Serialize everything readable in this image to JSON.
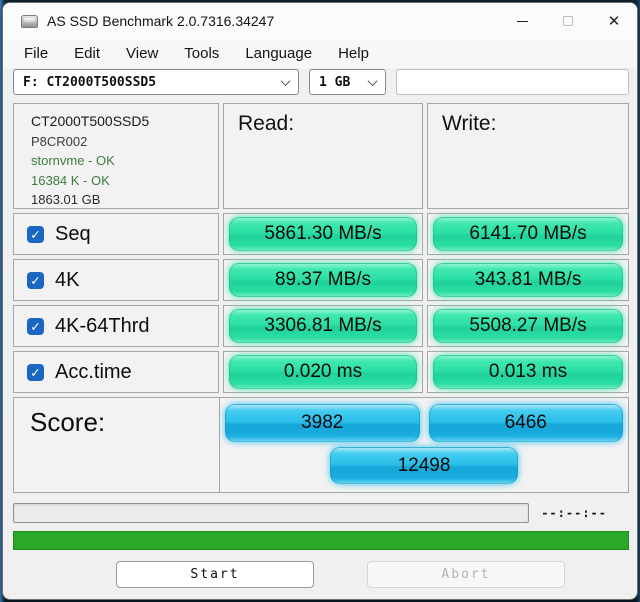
{
  "window": {
    "title": "AS SSD Benchmark 2.0.7316.34247"
  },
  "icons": {
    "close": "✕",
    "checkmark": "✓"
  },
  "menu": {
    "items": [
      {
        "label": "File"
      },
      {
        "label": "Edit"
      },
      {
        "label": "View"
      },
      {
        "label": "Tools"
      },
      {
        "label": "Language"
      },
      {
        "label": "Help"
      }
    ]
  },
  "toolbar": {
    "drive": "F: CT2000T500SSD5",
    "test_size": "1 GB"
  },
  "device": {
    "model": "CT2000T500SSD5",
    "firmware": "P8CR002",
    "driver_status": "stornvme - OK",
    "alignment_status": "16384 K - OK",
    "capacity": "1863.01 GB"
  },
  "results": {
    "read_header": "Read:",
    "write_header": "Write:",
    "rows": [
      {
        "label": "Seq",
        "checked": true,
        "read": "5861.30 MB/s",
        "write": "6141.70 MB/s"
      },
      {
        "label": "4K",
        "checked": true,
        "read": "89.37 MB/s",
        "write": "343.81 MB/s"
      },
      {
        "label": "4K-64Thrd",
        "checked": true,
        "read": "3306.81 MB/s",
        "write": "5508.27 MB/s"
      },
      {
        "label": "Acc.time",
        "checked": true,
        "read": "0.020 ms",
        "write": "0.013 ms"
      }
    ]
  },
  "score": {
    "label": "Score:",
    "read": "3982",
    "write": "6466",
    "total": "12498"
  },
  "progress": {
    "elapsed": "--:--:--",
    "task_percent": 0,
    "status_percent": 100
  },
  "buttons": {
    "start": "Start",
    "abort": "Abort",
    "abort_enabled": false
  },
  "colors": {
    "result_pill_green": "#2ddfa5",
    "score_pill_blue": "#23b9e5",
    "status_bar_green": "#2aa82a",
    "checkbox_blue": "#1a66c0",
    "ok_text_green": "#3e7d3e"
  }
}
